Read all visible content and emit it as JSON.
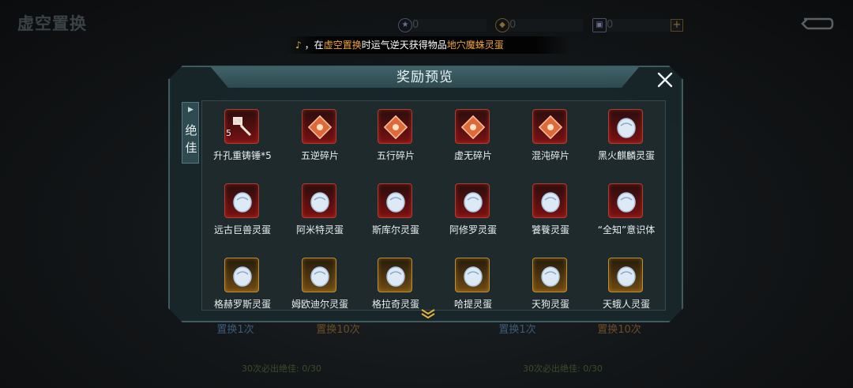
{
  "screen_title": "虚空置换",
  "currencies": [
    {
      "icon": "star-token-icon",
      "value": "0"
    },
    {
      "icon": "gold-coin-icon",
      "value": "0"
    },
    {
      "icon": "ticket-icon",
      "value": "0"
    }
  ],
  "add_currency_label": "+",
  "announcement": {
    "prefix": "，在",
    "place": "虚空置换",
    "middle": "时运气逆天获得物品",
    "item": "地穴魔蛛灵蛋"
  },
  "background_buttons": [
    {
      "label": "置换1次",
      "style": "blue"
    },
    {
      "label": "置换10次",
      "style": "gold"
    },
    {
      "label": "置换1次",
      "style": "blue"
    },
    {
      "label": "置换10次",
      "style": "gold"
    }
  ],
  "guarantee_texts": [
    "30次必出绝佳: 0/30",
    "30次必出绝佳: 0/30"
  ],
  "modal": {
    "title": "奖励预览",
    "side_tab": "绝佳",
    "items": [
      {
        "label": "升孔重铸锤*5",
        "qty": "5",
        "frame": "red",
        "icon": "hammer-icon"
      },
      {
        "label": "五逆碎片",
        "qty": "",
        "frame": "red",
        "icon": "fragment-icon"
      },
      {
        "label": "五行碎片",
        "qty": "",
        "frame": "red",
        "icon": "fragment-icon"
      },
      {
        "label": "虚无碎片",
        "qty": "",
        "frame": "red",
        "icon": "fragment-icon"
      },
      {
        "label": "混沌碎片",
        "qty": "",
        "frame": "red",
        "icon": "fragment-icon"
      },
      {
        "label": "黑火麒麟灵蛋",
        "qty": "",
        "frame": "red",
        "icon": "spirit-egg-icon"
      },
      {
        "label": "远古巨兽灵蛋",
        "qty": "",
        "frame": "red",
        "icon": "spirit-egg-icon"
      },
      {
        "label": "阿米特灵蛋",
        "qty": "",
        "frame": "red",
        "icon": "spirit-egg-icon"
      },
      {
        "label": "斯库尔灵蛋",
        "qty": "",
        "frame": "red",
        "icon": "spirit-egg-icon"
      },
      {
        "label": "阿修罗灵蛋",
        "qty": "",
        "frame": "red",
        "icon": "spirit-egg-icon"
      },
      {
        "label": "饕餮灵蛋",
        "qty": "",
        "frame": "red",
        "icon": "spirit-egg-icon"
      },
      {
        "label": "“全知”意识体",
        "qty": "",
        "frame": "red",
        "icon": "spirit-egg-icon"
      },
      {
        "label": "格赫罗斯灵蛋",
        "qty": "",
        "frame": "gold",
        "icon": "spirit-egg-icon"
      },
      {
        "label": "姆欧迪尔灵蛋",
        "qty": "",
        "frame": "gold",
        "icon": "spirit-egg-icon"
      },
      {
        "label": "格拉奇灵蛋",
        "qty": "",
        "frame": "gold",
        "icon": "spirit-egg-icon"
      },
      {
        "label": "哈提灵蛋",
        "qty": "",
        "frame": "gold",
        "icon": "spirit-egg-icon"
      },
      {
        "label": "天狗灵蛋",
        "qty": "",
        "frame": "gold",
        "icon": "spirit-egg-icon"
      },
      {
        "label": "天蛾人灵蛋",
        "qty": "",
        "frame": "gold",
        "icon": "spirit-egg-icon"
      }
    ]
  },
  "colors": {
    "accent": "#3d5b61",
    "red_frame": "#b23a2e",
    "gold_frame": "#c08c2e",
    "highlight": "#f0a23a"
  }
}
